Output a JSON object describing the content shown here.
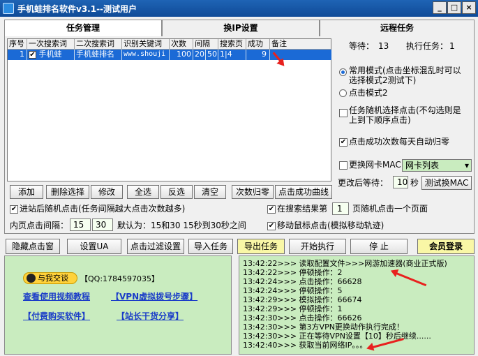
{
  "window": {
    "title": "手机蛙排名软件v3.1--测试用户",
    "min": "_",
    "max": "□",
    "close": "×"
  },
  "tabs": [
    "任务管理",
    "换IP设置",
    "远程任务"
  ],
  "table": {
    "headers": [
      "序号",
      "一次搜索词",
      "二次搜索词",
      "识别关键词",
      "次数",
      "间隔",
      "搜索页",
      "成功",
      "备注"
    ],
    "row": {
      "index": "1",
      "check": "✔",
      "first": "手机蛙",
      "second": "手机蛙排名",
      "keyword": "www.shouji",
      "count": "100",
      "interval_a": "20",
      "interval_b": "50",
      "pages": "1|4",
      "success": "9",
      "note": ""
    }
  },
  "status": {
    "wait_label": "等待：",
    "wait_value": "13",
    "exec_label": "执行任务：",
    "exec_value": "1"
  },
  "modes": {
    "normal": "常用模式(点击坐标混乱时可以选择模式2测试下)",
    "mode2": "点击模式2",
    "random": "任务随机选择点击(不勾选则是上到下顺序点击)",
    "reset": "点击成功次数每天自动归零"
  },
  "nic": {
    "label": "更换网卡MAC",
    "select": "网卡列表"
  },
  "after_wait": {
    "label": "更改后等待：",
    "value": "10",
    "unit": "秒",
    "button": "测试换MAC"
  },
  "buttons_row1": [
    "添加",
    "删除选择",
    "修改",
    "全选",
    "反选",
    "清空",
    "次数归零",
    "点击成功曲线"
  ],
  "options": {
    "random_click": "进站后随机点击(任务间隔越大点击次数越多)",
    "search_result_a": "在搜索结果第",
    "search_result_page": "1",
    "search_result_b": "页随机点击一个页面",
    "inner_label": "内页点击间隔：",
    "inner_a": "15",
    "inner_b": "30",
    "inner_default": "默认为：15和30 15秒到30秒之间",
    "mouse_move": "移动鼠标点击(模拟移动轨迹)"
  },
  "toolbar": [
    "隐藏点击窗",
    "设置UA",
    "点击过滤设置",
    "导入任务",
    "导出任务",
    "开始执行",
    "停 止",
    "会员登录"
  ],
  "info": {
    "chat": "与我交谈",
    "qq": "【QQ:1784597035】",
    "video": "查看使用视频教程",
    "vpn": "【VPN虚拟拨号步骤】",
    "buy": "【付费购买软件】",
    "shop": "【站长干货分享】"
  },
  "log": [
    "13:42:22>>> 读取配置文件>>>网游加速器(商业正式版)",
    "13:42:22>>> 停顿操作：2",
    "13:42:24>>> 点击操作：66628",
    "13:42:24>>> 停顿操作：5",
    "13:42:29>>> 模拟操作：66674",
    "13:42:29>>> 停顿操作：1",
    "13:42:30>>> 点击操作：66626",
    "13:42:30>>> 第3方VPN更换动作执行完成！",
    "13:42:30>>> 正在等待VPN设置【10】秒后继续......",
    "13:42:40>>> 获取当前网络IP。。。"
  ]
}
